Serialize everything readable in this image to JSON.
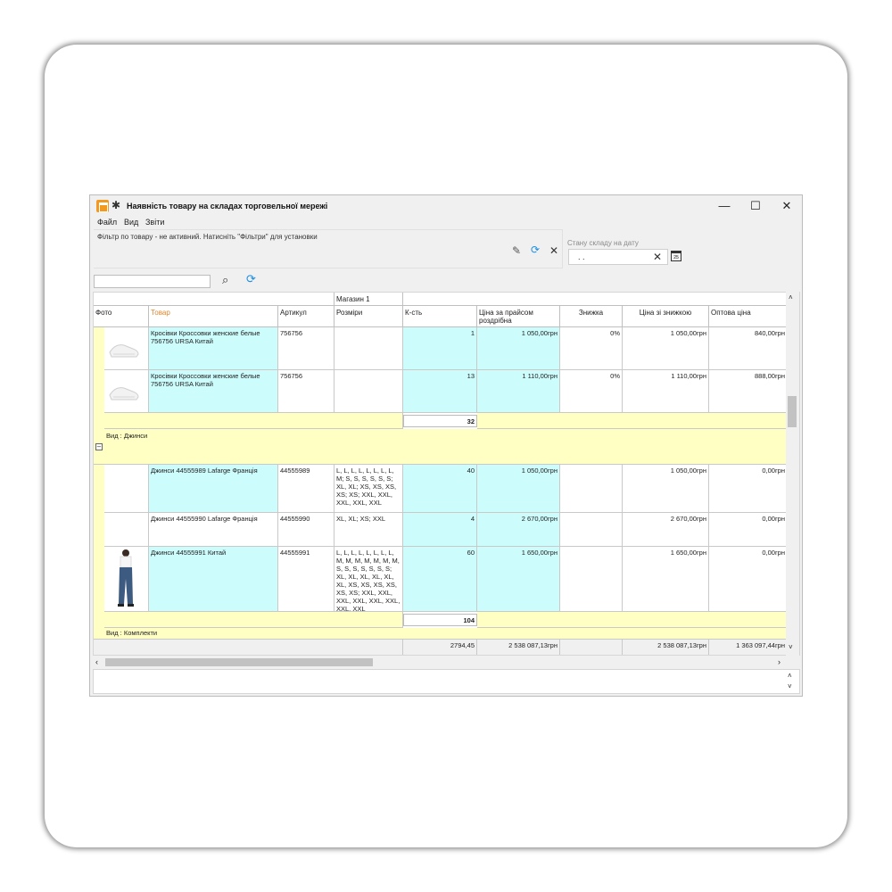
{
  "window": {
    "title": "Наявність товару на складах торговельної мережі",
    "controls": {
      "minimize": "—",
      "maximize": "☐",
      "close": "✕"
    }
  },
  "menu": [
    "Файл",
    "Вид",
    "Звіти"
  ],
  "filter": {
    "status_text": "Фільтр по товару - не активний. Натисніть \"Фільтри\" для установки",
    "date_label": "Стану складу на дату",
    "date_value": ". ."
  },
  "search": {
    "value": ""
  },
  "grid": {
    "store_header": "Магазин 1",
    "columns": [
      "Фото",
      "Товар",
      "Артикул",
      "Розміри",
      "К-сть",
      "Ціна за прайсом роздрібна",
      "Знижка",
      "Ціна зі знижкою",
      "Оптова ціна"
    ],
    "group1_rows": [
      {
        "product": "Кросівки Кроссовки женские белые 756756 URSA Китай",
        "article": "756756",
        "sizes": "",
        "qty": "1",
        "price": "1 050,00грн",
        "discount": "0%",
        "discounted": "1 050,00грн",
        "wholesale": "840,00грн"
      },
      {
        "product": "Кросівки Кроссовки женские белые 756756 URSA Китай",
        "article": "756756",
        "sizes": "",
        "qty": "13",
        "price": "1 110,00грн",
        "discount": "0%",
        "discounted": "1 110,00грн",
        "wholesale": "888,00грн"
      }
    ],
    "group1_total": "32",
    "group2_label": "Вид : Джинси",
    "group2_rows": [
      {
        "product": "Джинси 44555989 Lafarge Франція",
        "article": "44555989",
        "sizes": "L, L, L, L, L, L, L, L, M; S, S, S, S, S, S; XL, XL; XS, XS, XS, XS; XS; XXL, XXL, XXL, XXL, XXL",
        "qty": "40",
        "price": "1 050,00грн",
        "discount": "",
        "discounted": "1 050,00грн",
        "wholesale": "0,00грн"
      },
      {
        "product": "Джинси 44555990 Lafarge Франція",
        "article": "44555990",
        "sizes": "XL, XL; XS; XXL",
        "qty": "4",
        "price": "2 670,00грн",
        "discount": "",
        "discounted": "2 670,00грн",
        "wholesale": "0,00грн"
      },
      {
        "product": "Джинси 44555991 Китай",
        "article": "44555991",
        "sizes": "L, L, L, L, L, L, L, L, M, M, M, M, M, M, M, S, S, S, S, S, S, S; XL, XL, XL, XL, XL, XL, XS, XS, XS, XS, XS, XS; XXL, XXL, XXL, XXL, XXL, XXL, XXL, XXL",
        "qty": "60",
        "price": "1 650,00грн",
        "discount": "",
        "discounted": "1 650,00грн",
        "wholesale": "0,00грн"
      }
    ],
    "group2_total": "104",
    "group3_label": "Вид : Комплекти",
    "footer": {
      "qty": "2794,45",
      "price": "2 538 087,13грн",
      "discounted": "2 538 087,13грн",
      "wholesale": "1 363 097,44грн"
    }
  }
}
